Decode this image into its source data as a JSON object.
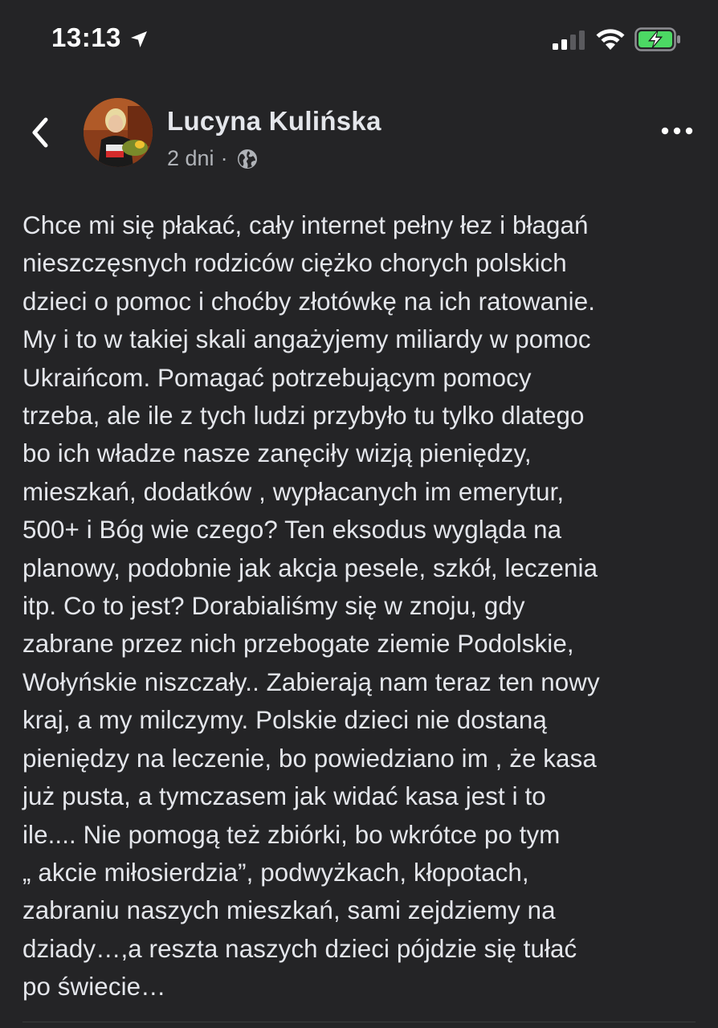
{
  "status_bar": {
    "time": "13:13",
    "battery_color": "#4cd964"
  },
  "post": {
    "author": "Lucyna Kulińska",
    "time_ago": "2 dni",
    "separator": "·",
    "privacy_icon": "globe-icon",
    "lines": [
      "Chce mi się płakać, cały internet pełny łez i błagań",
      "nieszczęsnych rodziców ciężko chorych polskich",
      "dzieci o pomoc i choćby złotówkę na ich ratowanie.",
      "My i to w takiej skali angażyjemy miliardy w pomoc",
      "Ukraińcom. Pomagać potrzebującym pomocy",
      "trzeba, ale ile z tych ludzi przybyło tu tylko dlatego",
      "bo ich władze nasze zanęciły wizją pieniędzy,",
      "mieszkań, dodatków , wypłacanych im emerytur,",
      "500+ i Bóg wie czego? Ten eksodus wygląda na",
      "planowy, podobnie jak akcja pesele, szkół, leczenia",
      "itp. Co to jest? Dorabialiśmy się w znoju, gdy",
      "zabrane przez nich przebogate ziemie Podolskie,",
      "Wołyńskie niszczały.. Zabierają nam teraz ten nowy",
      "kraj, a my milczymy. Polskie dzieci nie dostaną",
      "pieniędzy na leczenie, bo powiedziano im , że kasa",
      "już pusta, a tymczasem jak widać kasa jest i to",
      "ile.... Nie pomogą też zbiórki, bo wkrótce po tym",
      "„ akcie miłosierdzia”, podwyżkach, kłopotach,",
      "zabraniu naszych mieszkań, sami zejdziemy na",
      "dziady…,a reszta naszych dzieci pójdzie się tułać",
      "po świecie…"
    ]
  }
}
